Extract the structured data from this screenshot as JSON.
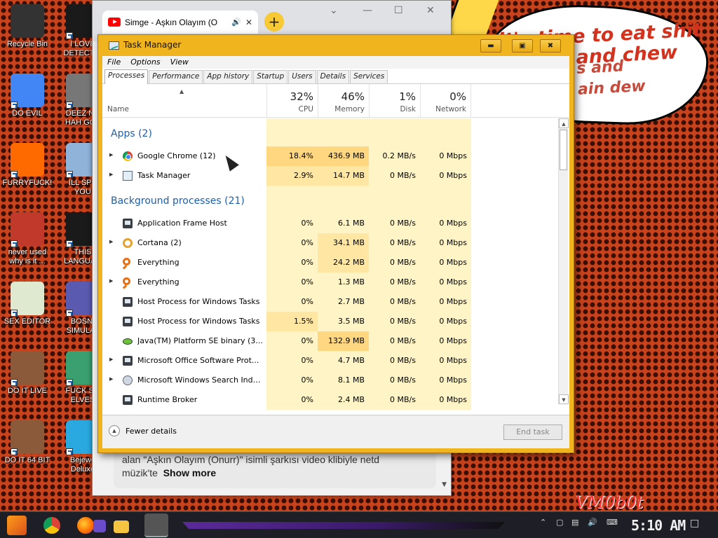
{
  "desktop": {
    "icons_col1": [
      {
        "label": "Recycle Bin",
        "label2": "",
        "icon": "recycle-bin-icon",
        "color": "#333333"
      },
      {
        "label": "DO EVIL",
        "label2": "",
        "icon": "chrome-icon",
        "color": "#4285f4"
      },
      {
        "label": "FURRYFUCK!",
        "label2": "",
        "icon": "firefox-icon",
        "color": "#ff6a00"
      },
      {
        "label": "never used",
        "label2": "why is it ...",
        "icon": "devcpp-icon",
        "color": "#c0392b"
      },
      {
        "label": "SEX EDITOR",
        "label2": "",
        "icon": "hxd-icon",
        "color": "#dfe9d0"
      },
      {
        "label": "DO IT LIVE",
        "label2": "",
        "icon": "portrait-icon",
        "color": "#8a5a3a"
      },
      {
        "label": "DO IT 64 BIT",
        "label2": "",
        "icon": "portrait-icon",
        "color": "#8a5a3a"
      }
    ],
    "icons_col2": [
      {
        "label": "I LOVE",
        "label2": "DETECTIN",
        "icon": "dj-icon",
        "color": "#1a1a1a"
      },
      {
        "label": "DEEZ NU",
        "label2": "HAH GOT",
        "icon": "windows-icon",
        "color": "#777777"
      },
      {
        "label": "ILL SPY",
        "label2": "YOU",
        "icon": "spy-icon",
        "color": "#8fb3d9"
      },
      {
        "label": "THIS",
        "label2": "LANGUAG",
        "icon": "go-icon",
        "color": "#1a1a1a"
      },
      {
        "label": "BOSNI",
        "label2": "SIMULAT",
        "icon": "bomb-icon",
        "color": "#5a5ab0"
      },
      {
        "label": "FUCK SO",
        "label2": "ELVES",
        "icon": "game-icon",
        "color": "#3aa070"
      },
      {
        "label": "Bejewe",
        "label2": "Deluxe",
        "icon": "gem-icon",
        "color": "#2aa8e0"
      }
    ]
  },
  "bubble": {
    "line1": "it's time to eat shit",
    "line2": "and chew",
    "line3": "s and",
    "line4": "ain dew"
  },
  "browser": {
    "tab_title": "Simge - Aşkın Olayım (O",
    "description_line1": "alan \"Aşkın Olayım (Onurr)\" isimli şarkısı video klibiyle netd",
    "description_line2": "müzik'te",
    "show_more": "Show more"
  },
  "task_manager": {
    "title": "Task Manager",
    "menu": [
      "File",
      "Options",
      "View"
    ],
    "tabs": [
      "Processes",
      "Performance",
      "App history",
      "Startup",
      "Users",
      "Details",
      "Services"
    ],
    "columns": {
      "name": "Name",
      "cpu": {
        "pct": "32%",
        "label": "CPU"
      },
      "memory": {
        "pct": "46%",
        "label": "Memory"
      },
      "disk": {
        "pct": "1%",
        "label": "Disk"
      },
      "network": {
        "pct": "0%",
        "label": "Network"
      }
    },
    "groups": [
      {
        "title": "Apps (2)",
        "rows": [
          {
            "name": "Google Chrome (12)",
            "expand": true,
            "icon": "chrome-icon",
            "cpu": "18.4%",
            "mem": "436.9 MB",
            "disk": "0.2 MB/s",
            "net": "0 Mbps"
          },
          {
            "name": "Task Manager",
            "expand": true,
            "icon": "task-manager-icon",
            "cpu": "2.9%",
            "mem": "14.7 MB",
            "disk": "0 MB/s",
            "net": "0 Mbps"
          }
        ]
      },
      {
        "title": "Background processes (21)",
        "rows": [
          {
            "name": "Application Frame Host",
            "expand": false,
            "icon": "app-icon",
            "cpu": "0%",
            "mem": "6.1 MB",
            "disk": "0 MB/s",
            "net": "0 Mbps"
          },
          {
            "name": "Cortana (2)",
            "expand": true,
            "icon": "cortana-icon",
            "cpu": "0%",
            "mem": "34.1 MB",
            "disk": "0 MB/s",
            "net": "0 Mbps"
          },
          {
            "name": "Everything",
            "expand": false,
            "icon": "everything-icon",
            "cpu": "0%",
            "mem": "24.2 MB",
            "disk": "0 MB/s",
            "net": "0 Mbps"
          },
          {
            "name": "Everything",
            "expand": true,
            "icon": "everything-icon",
            "cpu": "0%",
            "mem": "1.3 MB",
            "disk": "0 MB/s",
            "net": "0 Mbps"
          },
          {
            "name": "Host Process for Windows Tasks",
            "expand": false,
            "icon": "app-icon",
            "cpu": "0%",
            "mem": "2.7 MB",
            "disk": "0 MB/s",
            "net": "0 Mbps"
          },
          {
            "name": "Host Process for Windows Tasks",
            "expand": false,
            "icon": "app-icon",
            "cpu": "1.5%",
            "mem": "3.5 MB",
            "disk": "0 MB/s",
            "net": "0 Mbps"
          },
          {
            "name": "Java(TM) Platform SE binary (3...",
            "expand": false,
            "icon": "java-icon",
            "cpu": "0%",
            "mem": "132.9 MB",
            "disk": "0 MB/s",
            "net": "0 Mbps"
          },
          {
            "name": "Microsoft Office Software Prot...",
            "expand": true,
            "icon": "app-icon",
            "cpu": "0%",
            "mem": "4.7 MB",
            "disk": "0 MB/s",
            "net": "0 Mbps"
          },
          {
            "name": "Microsoft Windows Search Inde...",
            "expand": true,
            "icon": "search-indexer-icon",
            "cpu": "0%",
            "mem": "8.1 MB",
            "disk": "0 MB/s",
            "net": "0 Mbps"
          },
          {
            "name": "Runtime Broker",
            "expand": false,
            "icon": "app-icon",
            "cpu": "0%",
            "mem": "2.4 MB",
            "disk": "0 MB/s",
            "net": "0 Mbps"
          }
        ]
      }
    ],
    "fewer_details": "Fewer details",
    "end_task": "End task"
  },
  "watermark": "VM0b0t",
  "taskbar": {
    "clock": "5:10 AM"
  },
  "colors": {
    "desktop_bg": "#c8431c",
    "tm_frame": "#f0b41e",
    "group_title": "#1d5fa8",
    "cell_bg": "#fff4c6"
  }
}
